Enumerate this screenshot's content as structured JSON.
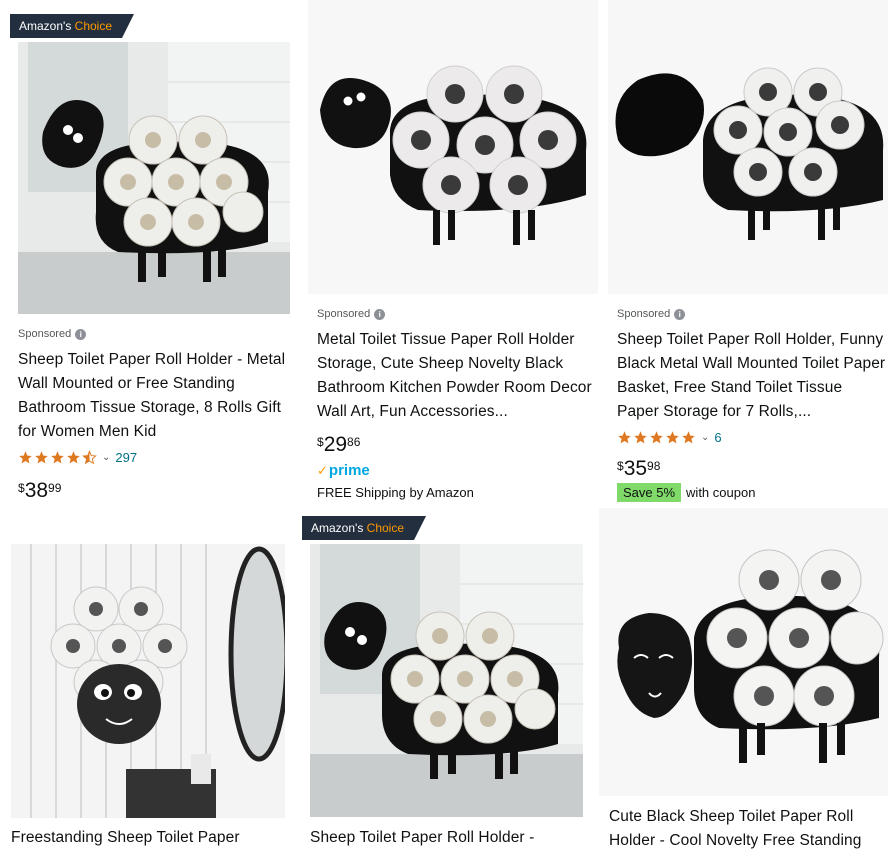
{
  "colors": {
    "badge_bg": "#232f3e",
    "badge_accent": "#ff9900",
    "link": "#007185",
    "star": "#de7921",
    "coupon": "#7fda69",
    "prime": "#00a8e1"
  },
  "badges": {
    "amazon": "Amazon's",
    "choice": "Choice"
  },
  "sponsored_label": "Sponsored",
  "products": [
    {
      "title": "Sheep Toilet Paper Roll Holder - Metal Wall Mounted or Free Standing Bathroom Tissue Storage, 8 Rolls Gift for Women Men Kid",
      "sponsored": true,
      "amazons_choice": true,
      "rating": 4.5,
      "review_count": "297",
      "price": {
        "symbol": "$",
        "whole": "38",
        "fraction": "99"
      },
      "image_icon": "sheep-holder-photo-icon"
    },
    {
      "title": "Metal Toilet Tissue Paper Roll Holder Storage, Cute Sheep Novelty Black Bathroom Kitchen Powder Room Decor Wall Art, Fun Accessories...",
      "sponsored": true,
      "amazons_choice": false,
      "price": {
        "symbol": "$",
        "whole": "29",
        "fraction": "86"
      },
      "prime_label": "prime",
      "shipping": "FREE Shipping by Amazon",
      "image_icon": "sheep-holder-product-icon"
    },
    {
      "title": "Sheep Toilet Paper Roll Holder, Funny Black Metal Wall Mounted Toilet Paper Basket, Free Stand Toilet Tissue Paper Storage for 7 Rolls,...",
      "sponsored": true,
      "amazons_choice": false,
      "rating": 5.0,
      "review_count": "6",
      "price": {
        "symbol": "$",
        "whole": "35",
        "fraction": "98"
      },
      "coupon": {
        "badge": "Save 5%",
        "text": "with coupon"
      },
      "image_icon": "sheep-holder-product-icon"
    },
    {
      "title": "Freestanding Sheep Toilet Paper",
      "sponsored": false,
      "amazons_choice": false,
      "image_icon": "sheep-wall-holder-photo-icon"
    },
    {
      "title": "Sheep Toilet Paper Roll Holder -",
      "sponsored": false,
      "amazons_choice": true,
      "image_icon": "sheep-holder-photo-icon"
    },
    {
      "title": "Cute Black Sheep Toilet Paper Roll Holder - Cool Novelty Free Standing",
      "sponsored": false,
      "amazons_choice": false,
      "image_icon": "sheep-smiling-holder-icon"
    }
  ]
}
